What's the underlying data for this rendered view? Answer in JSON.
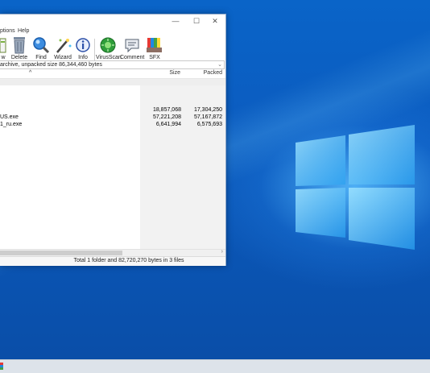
{
  "window": {
    "menu": [
      "ptions",
      "Help"
    ],
    "toolbar": [
      {
        "label": "w",
        "icon": "view-icon"
      },
      {
        "label": "Delete",
        "icon": "delete-icon"
      },
      {
        "label": "Find",
        "icon": "find-icon"
      },
      {
        "label": "Wizard",
        "icon": "wizard-icon"
      },
      {
        "label": "Info",
        "icon": "info-icon"
      },
      {
        "label": "VirusScan",
        "icon": "virusscan-icon"
      },
      {
        "label": "Comment",
        "icon": "comment-icon"
      },
      {
        "label": "SFX",
        "icon": "sfx-icon"
      }
    ],
    "address": "archive, unpacked size 86,344,460 bytes",
    "columns": {
      "size": "Size",
      "packed": "Packed"
    },
    "files": [
      {
        "name": "",
        "size": "18,857,068",
        "packed": "17,304,250"
      },
      {
        "name": "US.exe",
        "size": "57,221,208",
        "packed": "57,167,872"
      },
      {
        "name": "1_ru.exe",
        "size": "6,641,994",
        "packed": "6,575,693"
      }
    ],
    "status": "Total 1 folder and 82,720,270 bytes in 3 files",
    "controls": {
      "minimize": "—",
      "maximize": "☐",
      "close": "✕"
    }
  },
  "colors": {
    "desktop": "#0a5cc0",
    "logo": "#6fd0ff"
  }
}
